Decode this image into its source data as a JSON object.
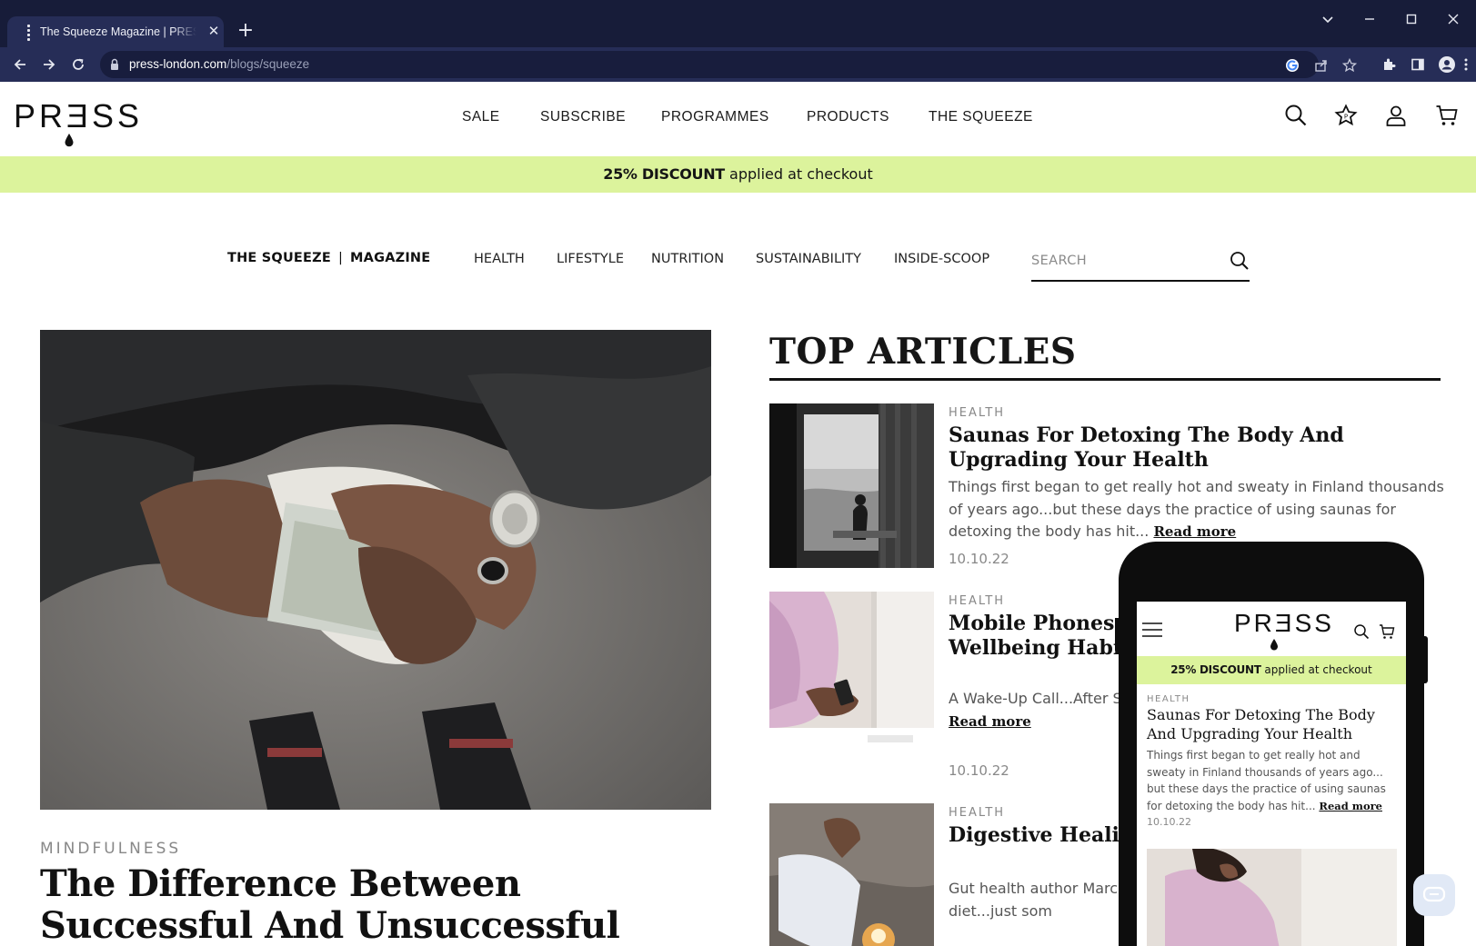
{
  "browser": {
    "tab_title": "The Squeeze Magazine | PRESS London",
    "url_host": "press-london.com",
    "url_path": "/blogs/squeeze"
  },
  "header": {
    "logo_text": "PRƎSS",
    "nav": [
      "SALE",
      "SUBSCRIBE",
      "PROGRAMMES",
      "PRODUCTS",
      "THE SQUEEZE"
    ]
  },
  "promo": {
    "bold": "25% DISCOUNT",
    "rest": " applied at checkout"
  },
  "magazine": {
    "title_left": "THE SQUEEZE",
    "title_sep": "|",
    "title_right": "MAGAZINE",
    "categories": [
      "HEALTH",
      "LIFESTYLE",
      "NUTRITION",
      "SUSTAINABILITY",
      "INSIDE-SCOOP"
    ],
    "search_placeholder": "SEARCH"
  },
  "hero": {
    "category": "MINDFULNESS",
    "title": "The Difference Between Successful And Unsuccessful People"
  },
  "top_articles": {
    "heading": "TOP ARTICLES",
    "read_more": "Read more",
    "items": [
      {
        "category": "HEALTH",
        "title": "Saunas For Detoxing The Body And Upgrading Your Health",
        "excerpt": "Things first began to get really hot and sweaty in Finland thousands of years ago...but these days the practice of using saunas for detoxing the body has hit...",
        "date": "10.10.22"
      },
      {
        "category": "HEALTH",
        "title": "Mobile Phones And How To Improve Your Wellbeing Habits",
        "excerpt": "A Wake-Up Call...After S... you live to the grand old ag... times...",
        "date": "10.10.22"
      },
      {
        "category": "HEALTH",
        "title": "Digestive Healing | Realise About Their",
        "excerpt": "Gut health author Marc... cause chaos in the dige... unhealthy diet...just som",
        "date": ""
      }
    ]
  },
  "phone": {
    "logo_text": "PRƎSS",
    "promo_bold": "25% DISCOUNT",
    "promo_rest": " applied at checkout",
    "category": "HEALTH",
    "title": "Saunas For Detoxing The Body And Upgrading Your Health",
    "excerpt": "Things first began to get really hot and sweaty in Finland thousands of years ago... but these days the practice of using saunas for detoxing the body has hit...",
    "read_more": "Read more",
    "date": "10.10.22"
  },
  "colors": {
    "chrome_bg": "#171c39",
    "toolbar_bg": "#262d57",
    "promo_bg": "#dcf39c",
    "text": "#111111",
    "muted": "#888888"
  },
  "icons": {
    "browser": [
      "back-icon",
      "forward-icon",
      "reload-icon",
      "lock-icon",
      "google-icon",
      "share-icon",
      "star-icon",
      "extensions-icon",
      "sidepanel-icon",
      "profile-icon",
      "menu-icon"
    ],
    "site": [
      "search-icon",
      "rewards-icon",
      "account-icon",
      "cart-icon"
    ]
  }
}
